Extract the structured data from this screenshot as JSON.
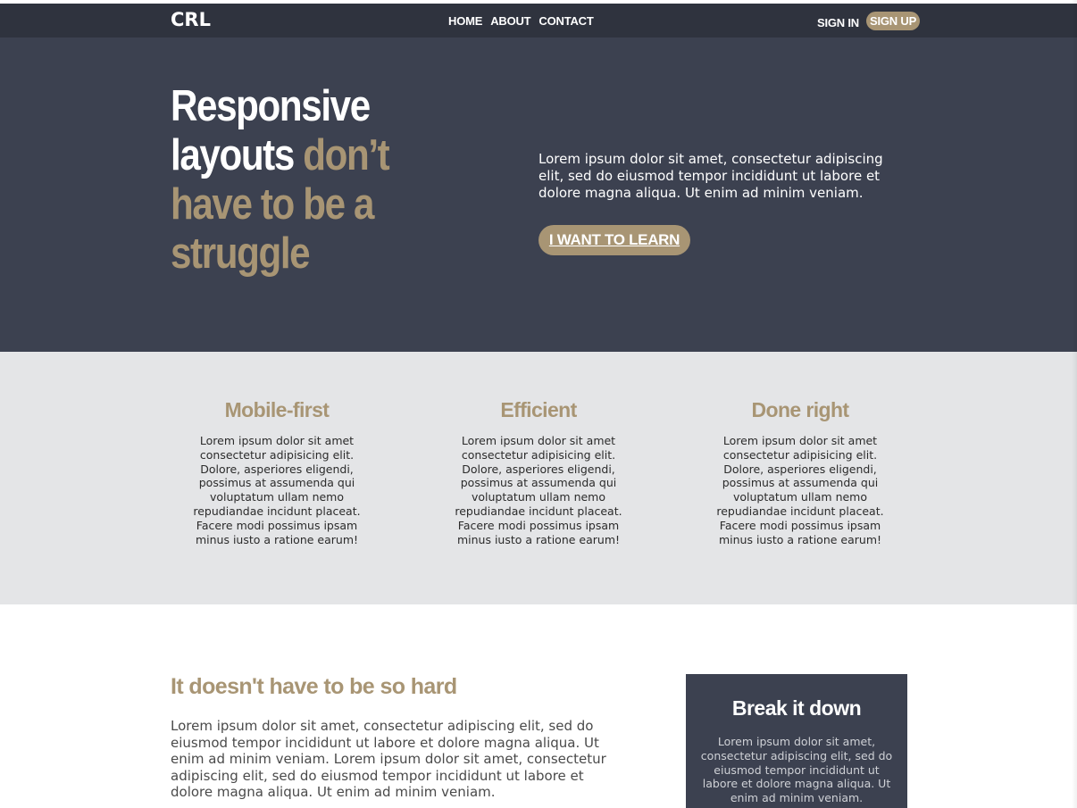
{
  "nav": {
    "logo": "CRL",
    "links": [
      "HOME",
      "ABOUT",
      "CONTACT"
    ],
    "sign_in": "SIGN IN",
    "sign_up": "SIGN UP"
  },
  "hero": {
    "title_line1": "Responsive",
    "title_line2_white": "layouts ",
    "title_line2_accent": "don’t",
    "title_line3": "have to be a",
    "title_line4": "struggle",
    "text": "Lorem ipsum dolor sit amet, consectetur adipiscing elit, sed do eiusmod tempor incididunt ut labore et dolore magna aliqua. Ut enim ad minim veniam.",
    "cta_label": "I WANT TO LEARN"
  },
  "features": [
    {
      "title": "Mobile-first",
      "text": "Lorem ipsum dolor sit amet consectetur adipisicing elit. Dolore, asperiores eligendi, possimus at assumenda qui voluptatum ullam nemo repudiandae incidunt placeat. Facere modi possimus ipsam minus iusto a ratione earum!"
    },
    {
      "title": "Efficient",
      "text": "Lorem ipsum dolor sit amet consectetur adipisicing elit. Dolore, asperiores eligendi, possimus at assumenda qui voluptatum ullam nemo repudiandae incidunt placeat. Facere modi possimus ipsam minus iusto a ratione earum!"
    },
    {
      "title": "Done right",
      "text": "Lorem ipsum dolor sit amet consectetur adipisicing elit. Dolore, asperiores eligendi, possimus at assumenda qui voluptatum ullam nemo repudiandae incidunt placeat. Facere modi possimus ipsam minus iusto a ratione earum!"
    }
  ],
  "content": {
    "heading": "It doesn't have to be so hard",
    "body": "Lorem ipsum dolor sit amet, consectetur adipiscing elit, sed do eiusmod tempor incididunt ut labore et dolore magna aliqua. Ut enim ad minim veniam. Lorem ipsum dolor sit amet, consectetur adipiscing elit, sed do eiusmod tempor incididunt ut labore et dolore magna aliqua. Ut enim ad minim veniam.",
    "aside_title": "Break it down",
    "aside_text": "Lorem ipsum dolor sit amet, consectetur adipiscing elit, sed do eiusmod tempor incididunt ut labore et dolore magna aliqua. Ut enim ad minim veniam."
  },
  "colors": {
    "nav_bg": "#2f333e",
    "hero_bg": "#3c4150",
    "accent": "#a89574",
    "features_bg": "#e4e5e7"
  }
}
